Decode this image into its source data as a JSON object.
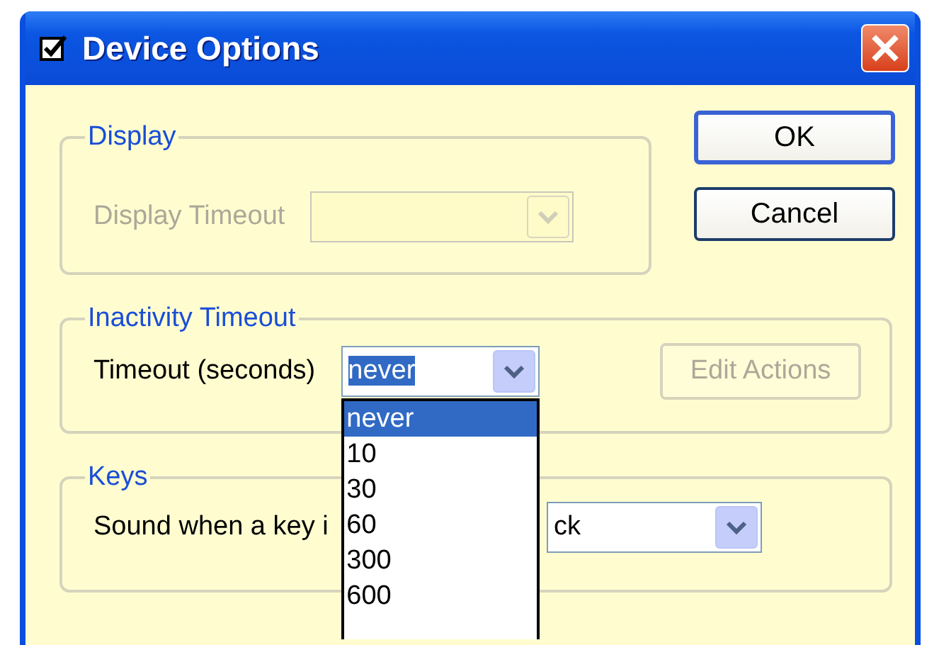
{
  "window": {
    "title": "Device Options"
  },
  "display": {
    "legend": "Display",
    "label": "Display Timeout",
    "disabled": true
  },
  "buttons": [
    {
      "label": "OK",
      "default": true
    },
    {
      "label": "Cancel",
      "default": false
    }
  ],
  "inactivity": {
    "legend": "Inactivity Timeout",
    "label": "Timeout (seconds)",
    "value": "never",
    "expanded": true,
    "options": [
      {
        "label": "never",
        "selected": true
      },
      {
        "label": "10",
        "selected": false
      },
      {
        "label": "30",
        "selected": false
      },
      {
        "label": "60",
        "selected": false
      },
      {
        "label": "300",
        "selected": false
      },
      {
        "label": "600",
        "selected": false
      }
    ],
    "edit_button": {
      "label": "Edit Actions",
      "disabled": true
    }
  },
  "keys": {
    "legend": "Keys",
    "label": "Sound when a key i",
    "value": "ck"
  }
}
